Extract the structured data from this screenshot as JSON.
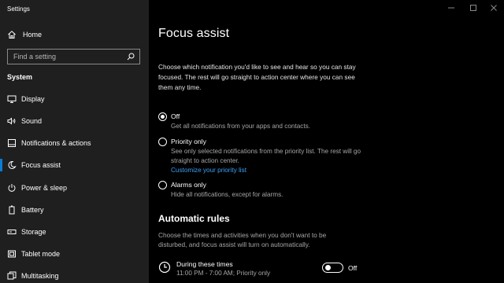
{
  "window": {
    "title": "Settings",
    "controls": [
      "minimize-icon",
      "maximize-icon",
      "close-icon"
    ]
  },
  "sidebar": {
    "home_label": "Home",
    "search_placeholder": "Find a setting",
    "section_header": "System",
    "items": [
      {
        "label": "Display",
        "icon": "display-icon",
        "active": false
      },
      {
        "label": "Sound",
        "icon": "sound-icon",
        "active": false
      },
      {
        "label": "Notifications & actions",
        "icon": "notifications-icon",
        "active": false
      },
      {
        "label": "Focus assist",
        "icon": "focus-assist-icon",
        "active": true
      },
      {
        "label": "Power & sleep",
        "icon": "power-icon",
        "active": false
      },
      {
        "label": "Battery",
        "icon": "battery-icon",
        "active": false
      },
      {
        "label": "Storage",
        "icon": "storage-icon",
        "active": false
      },
      {
        "label": "Tablet mode",
        "icon": "tablet-mode-icon",
        "active": false
      },
      {
        "label": "Multitasking",
        "icon": "multitasking-icon",
        "active": false
      }
    ]
  },
  "main": {
    "title": "Focus assist",
    "description": "Choose which notification you'd like to see and hear so you can stay focused. The rest will go straight to action center where you can see them any time.",
    "options": [
      {
        "title": "Off",
        "subtitle": "Get all notifications from your apps and contacts.",
        "selected": true
      },
      {
        "title": "Priority only",
        "subtitle": "See only selected notifications from the priority list. The rest will go straight to action center.",
        "link": "Customize your priority list",
        "selected": false
      },
      {
        "title": "Alarms only",
        "subtitle": "Hide all notifications, except for alarms.",
        "selected": false
      }
    ],
    "automatic_rules": {
      "title": "Automatic rules",
      "description": "Choose the times and activities when you don't want to be disturbed, and focus assist will turn on automatically.",
      "rule": {
        "title": "During these times",
        "subtitle": "11:00 PM - 7:00 AM; Priority only",
        "toggle_state": "Off",
        "icon": "clock-icon"
      }
    }
  },
  "colors": {
    "sidebar_bg": "#1f1f1f",
    "main_bg": "#000000",
    "accent": "#0a7cd4",
    "link": "#3c9ff5",
    "secondary_text": "#a6a6a6"
  }
}
